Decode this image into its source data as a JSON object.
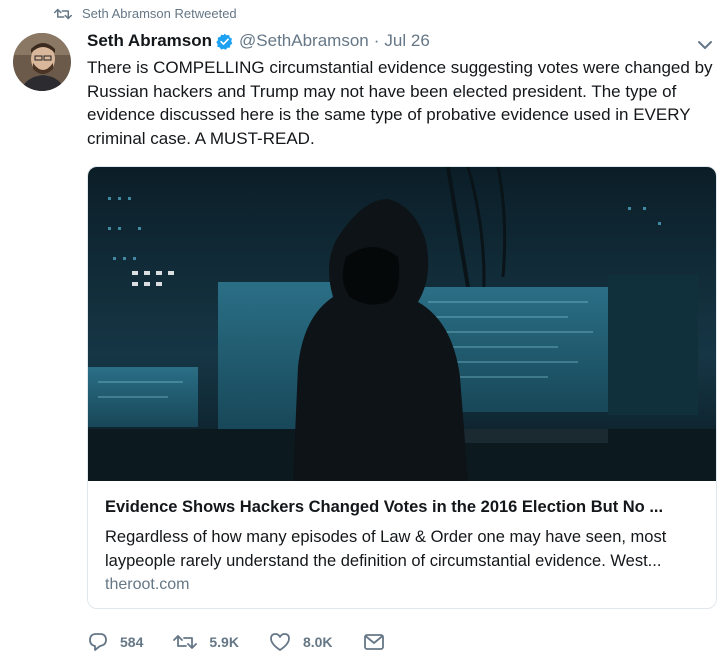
{
  "retweet_label": "Seth Abramson Retweeted",
  "author": {
    "name": "Seth Abramson",
    "handle": "@SethAbramson",
    "separator": "·",
    "date": "Jul 26",
    "verified": true
  },
  "tweet_text": "There is COMPELLING circumstantial evidence suggesting votes were changed by Russian hackers and Trump may not have been elected president. The type of evidence discussed here is the same type of probative evidence used in EVERY criminal case. A MUST-READ.",
  "card": {
    "title": "Evidence Shows Hackers Changed Votes in the 2016 Election But No ...",
    "description": "Regardless of how many episodes of Law & Order one may have seen, most laypeople rarely understand the definition of circumstantial evidence. West...",
    "domain": "theroot.com"
  },
  "actions": {
    "replies": "584",
    "retweets": "5.9K",
    "likes": "8.0K"
  },
  "colors": {
    "secondary_text": "#657786",
    "verified_blue": "#1da1f2",
    "border": "#e1e8ed"
  },
  "icons": [
    "retweet-icon",
    "verified-badge-icon",
    "chevron-down-icon",
    "reply-icon",
    "like-icon",
    "direct-message-icon"
  ]
}
